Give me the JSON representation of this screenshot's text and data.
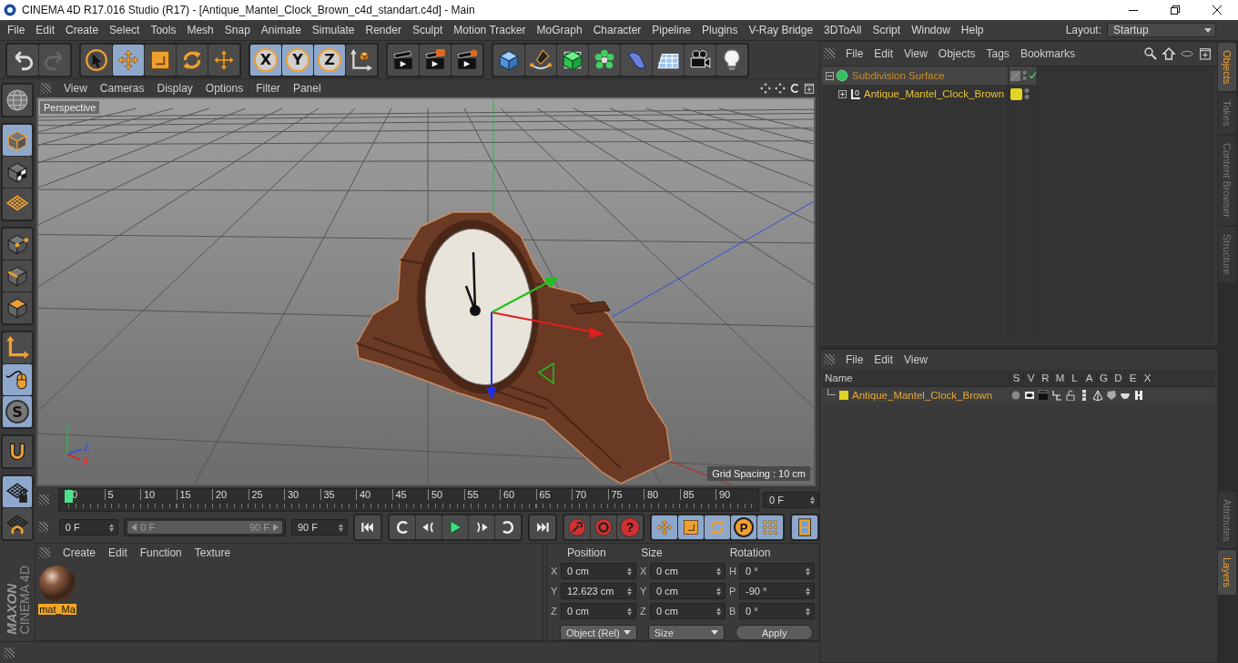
{
  "window": {
    "title": "CINEMA 4D R17.016 Studio (R17) - [Antique_Mantel_Clock_Brown_c4d_standart.c4d] - Main"
  },
  "menu_bar": [
    "File",
    "Edit",
    "Create",
    "Select",
    "Tools",
    "Mesh",
    "Snap",
    "Animate",
    "Simulate",
    "Render",
    "Sculpt",
    "Motion Tracker",
    "MoGraph",
    "Character",
    "Pipeline",
    "Plugins",
    "V-Ray Bridge",
    "3DToAll",
    "Script",
    "Window",
    "Help"
  ],
  "layout": {
    "label": "Layout:",
    "value": "Startup"
  },
  "toolbar": [
    {
      "tools": [
        {
          "kind": "undo",
          "selected": false
        },
        {
          "kind": "redo",
          "selected": false
        }
      ]
    },
    {
      "tools": [
        {
          "kind": "select",
          "selected": false
        },
        {
          "kind": "move",
          "selected": true
        },
        {
          "kind": "scale",
          "selected": false
        },
        {
          "kind": "rotate",
          "selected": false
        },
        {
          "kind": "move",
          "selected": false
        }
      ]
    },
    {
      "tools": [
        {
          "kind": "axis",
          "label": "X",
          "selected": true
        },
        {
          "kind": "axis",
          "label": "Y",
          "selected": true
        },
        {
          "kind": "axis",
          "label": "Z",
          "selected": true
        },
        {
          "kind": "coord",
          "selected": false
        }
      ]
    },
    {
      "tools": [
        {
          "kind": "render-view",
          "selected": false
        },
        {
          "kind": "render-picture",
          "selected": false
        },
        {
          "kind": "render-settings",
          "selected": false
        }
      ]
    },
    {
      "tools": [
        {
          "kind": "cube",
          "selected": false
        },
        {
          "kind": "pen",
          "selected": false
        },
        {
          "kind": "subdiv",
          "selected": false
        },
        {
          "kind": "cloner",
          "selected": false
        },
        {
          "kind": "deformer",
          "selected": false
        },
        {
          "kind": "floor",
          "selected": false
        },
        {
          "kind": "camera",
          "selected": false
        },
        {
          "kind": "light",
          "selected": false
        }
      ]
    }
  ],
  "left_tools": [
    {
      "tools": [
        {
          "kind": "sphere",
          "selected": false
        }
      ]
    },
    {
      "tools": [
        {
          "kind": "model",
          "selected": true
        },
        {
          "kind": "texture",
          "selected": false
        },
        {
          "kind": "workplane",
          "selected": false
        }
      ]
    },
    {
      "tools": [
        {
          "kind": "points",
          "selected": false
        },
        {
          "kind": "edges",
          "selected": false
        },
        {
          "kind": "polygons",
          "selected": false
        }
      ]
    },
    {
      "tools": [
        {
          "kind": "axis-mode",
          "selected": false
        },
        {
          "kind": "tweak",
          "selected": true
        },
        {
          "kind": "solo",
          "label": "S",
          "selected": true
        }
      ]
    },
    {
      "tools": [
        {
          "kind": "magnet",
          "selected": false
        }
      ]
    },
    {
      "tools": [
        {
          "kind": "grid-lock",
          "selected": true
        },
        {
          "kind": "grid-rotate",
          "selected": false
        }
      ]
    }
  ],
  "logo": {
    "brand": "MAXON",
    "product": "CINEMA 4D"
  },
  "viewport": {
    "menu": [
      "View",
      "Cameras",
      "Display",
      "Options",
      "Filter",
      "Panel"
    ],
    "camera": "Perspective",
    "grid_spacing": "Grid Spacing : 10 cm",
    "axis_labels": [
      "Y",
      "Z",
      "X"
    ]
  },
  "timeline": {
    "ticks": [
      "0",
      "5",
      "10",
      "15",
      "20",
      "25",
      "30",
      "35",
      "40",
      "45",
      "50",
      "55",
      "60",
      "65",
      "70",
      "75",
      "80",
      "85",
      "90"
    ],
    "playhead": {
      "level": 0
    },
    "current_frame": "0 F"
  },
  "transport": {
    "start": "0 F",
    "range_start": "0 F",
    "range_end": "90 F",
    "range": {
      "level": 1
    },
    "end": "90 F",
    "playback": [
      {
        "kind": "first"
      },
      {
        "kind": "prev-key"
      },
      {
        "kind": "prev-frame"
      },
      {
        "kind": "play"
      },
      {
        "kind": "next-frame"
      },
      {
        "kind": "next-key"
      },
      {
        "kind": "last"
      }
    ],
    "keys": [
      {
        "kind": "record"
      },
      {
        "kind": "autokey"
      },
      {
        "kind": "help",
        "label": "?"
      }
    ],
    "modes": [
      {
        "kind": "move",
        "selected": true
      },
      {
        "kind": "scale",
        "selected": true
      },
      {
        "kind": "rotate",
        "selected": true
      },
      {
        "kind": "param",
        "label": "P",
        "selected": true
      },
      {
        "kind": "dots",
        "selected": true
      }
    ],
    "timeline_button": {
      "selected": true
    }
  },
  "materials": {
    "menu": [
      "Create",
      "Edit",
      "Function",
      "Texture"
    ],
    "items": [
      {
        "name": "mat_Ma",
        "selected": true
      }
    ]
  },
  "coordinates": {
    "headers": [
      "Position",
      "Size",
      "Rotation"
    ],
    "rows": [
      {
        "cells": [
          {
            "axis": "X",
            "value": "0 cm"
          },
          {
            "axis": "X",
            "value": "0 cm"
          },
          {
            "axis": "H",
            "value": "0 °"
          }
        ]
      },
      {
        "cells": [
          {
            "axis": "Y",
            "value": "12.623 cm"
          },
          {
            "axis": "Y",
            "value": "0 cm"
          },
          {
            "axis": "P",
            "value": "-90 °"
          }
        ]
      },
      {
        "cells": [
          {
            "axis": "Z",
            "value": "0 cm"
          },
          {
            "axis": "Z",
            "value": "0 cm"
          },
          {
            "axis": "B",
            "value": "0 °"
          }
        ]
      }
    ],
    "mode": "Object (Rel)",
    "size_mode": "Size",
    "apply": "Apply"
  },
  "objects": {
    "menu": [
      "File",
      "Edit",
      "View",
      "Objects",
      "Tags",
      "Bookmarks"
    ],
    "tree": [
      {
        "name": "Subdivision Surface",
        "kind": "subdiv",
        "expanded": true,
        "enabled": true,
        "children": [
          {
            "name": "Antique_Mantel_Clock_Brown",
            "kind": "null",
            "badge": "0",
            "expanded": false,
            "color": "#e0d323"
          }
        ]
      }
    ]
  },
  "layers": {
    "menu": [
      "File",
      "Edit",
      "View"
    ],
    "columns": [
      "Name",
      "S",
      "V",
      "R",
      "M",
      "L",
      "A",
      "G",
      "D",
      "E",
      "X"
    ],
    "rows": [
      {
        "name": "Antique_Mantel_Clock_Brown",
        "color": "#e0d323"
      }
    ]
  },
  "side_tabs": [
    {
      "label": "Objects",
      "selected": true
    },
    {
      "label": "Takes",
      "selected": false
    },
    {
      "label": "Content Browser",
      "selected": false
    },
    {
      "label": "Structure",
      "selected": false
    }
  ],
  "lower_tabs": [
    {
      "label": "Attributes",
      "selected": false
    },
    {
      "label": "Layers",
      "selected": true
    }
  ]
}
